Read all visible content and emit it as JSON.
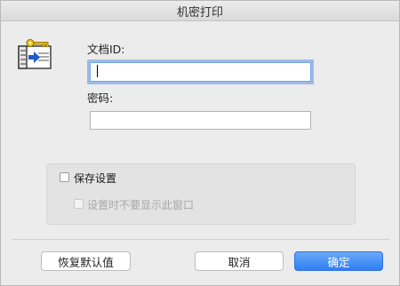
{
  "window": {
    "title": "机密打印"
  },
  "icons": {
    "app": "confidential-print-key-icon"
  },
  "form": {
    "doc_id_label": "文档ID:",
    "doc_id_value": "",
    "password_label": "密码:",
    "password_value": ""
  },
  "options": {
    "save_settings_label": "保存设置",
    "save_settings_checked": false,
    "hide_on_set_label": "设置时不要显示此窗口",
    "hide_on_set_checked": false,
    "hide_on_set_enabled": false
  },
  "buttons": {
    "restore_defaults": "恢复默认值",
    "cancel": "取消",
    "ok": "确定"
  },
  "colors": {
    "accent": "#2f7ef4",
    "focus_ring": "#5c92e6",
    "window_bg": "#ececec"
  }
}
